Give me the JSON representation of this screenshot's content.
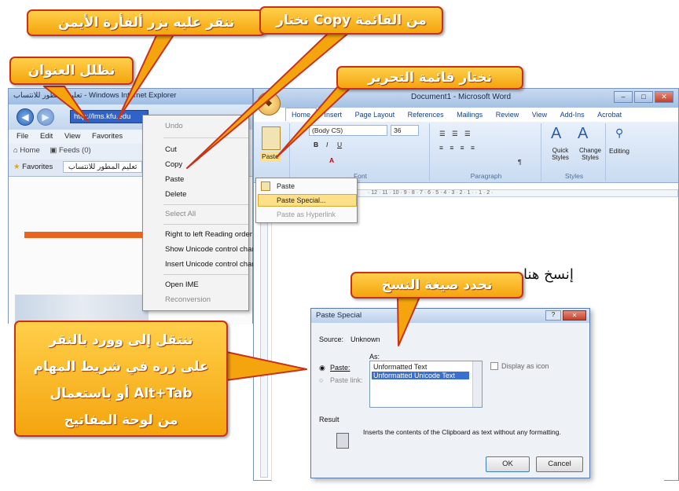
{
  "callouts": {
    "right_click": "ننقر عليه بزر ألفأرة الأيمن",
    "choose_copy": "نختار Copy من القائمة",
    "highlight_address": "نظلل العنوان",
    "edit_menu": "نختار قائمة التحرير",
    "select_format": "نحدد صيغة النسخ",
    "switch_to_word": [
      "ننتقل إلى وورد بالنقر",
      "على زره في شريط المهام",
      "أو باستعمال Alt+Tab",
      "من لوحة المفاتيح"
    ]
  },
  "ie": {
    "title": "تعليم المطور للانتساب - Windows Internet Explorer",
    "url": "http://lms.kfu.edu",
    "menu": [
      "File",
      "Edit",
      "View",
      "Favorites"
    ],
    "toolbar": [
      "Home",
      "Feeds (0)"
    ],
    "favorites_label": "Favorites",
    "tab_title": "تعليم المطور للانتساب"
  },
  "context_menu": {
    "items": [
      "Undo",
      "Cut",
      "Copy",
      "Paste",
      "Delete",
      "Select All",
      "Right to left Reading order",
      "Show Unicode control characters",
      "Insert Unicode control character",
      "Open IME",
      "Reconversion"
    ]
  },
  "word": {
    "title": "Document1 - Microsoft Word",
    "tabs": [
      "Home",
      "Insert",
      "Page Layout",
      "References",
      "Mailings",
      "Review",
      "View",
      "Add-Ins",
      "Acrobat"
    ],
    "font_name": "(Body CS)",
    "font_size": "36",
    "groups": [
      "Font",
      "Paragraph",
      "Styles",
      "Editing"
    ],
    "paste_label": "Paste",
    "quick_styles": "Quick Styles",
    "change_styles": "Change Styles",
    "editing": "Editing",
    "doc_text": "إنسخ هنا",
    "paste_menu": [
      "Paste",
      "Paste Special...",
      "Paste as Hyperlink"
    ]
  },
  "dialog": {
    "title": "Paste Special",
    "source_label": "Source:",
    "source_value": "Unknown",
    "as_label": "As:",
    "paste_radio": "Paste:",
    "paste_link_radio": "Paste link:",
    "formats": [
      "Unformatted Text",
      "Unformatted Unicode Text"
    ],
    "selected_format": "Unformatted Unicode Text",
    "display_as_icon": "Display as icon",
    "result_label": "Result",
    "result_text": "Inserts the contents of the Clipboard as text without any formatting.",
    "ok": "OK",
    "cancel": "Cancel"
  },
  "colors": {
    "callout_fill": "#f4a40d",
    "callout_border": "#c8311b",
    "selection": "#3a6fd0"
  }
}
